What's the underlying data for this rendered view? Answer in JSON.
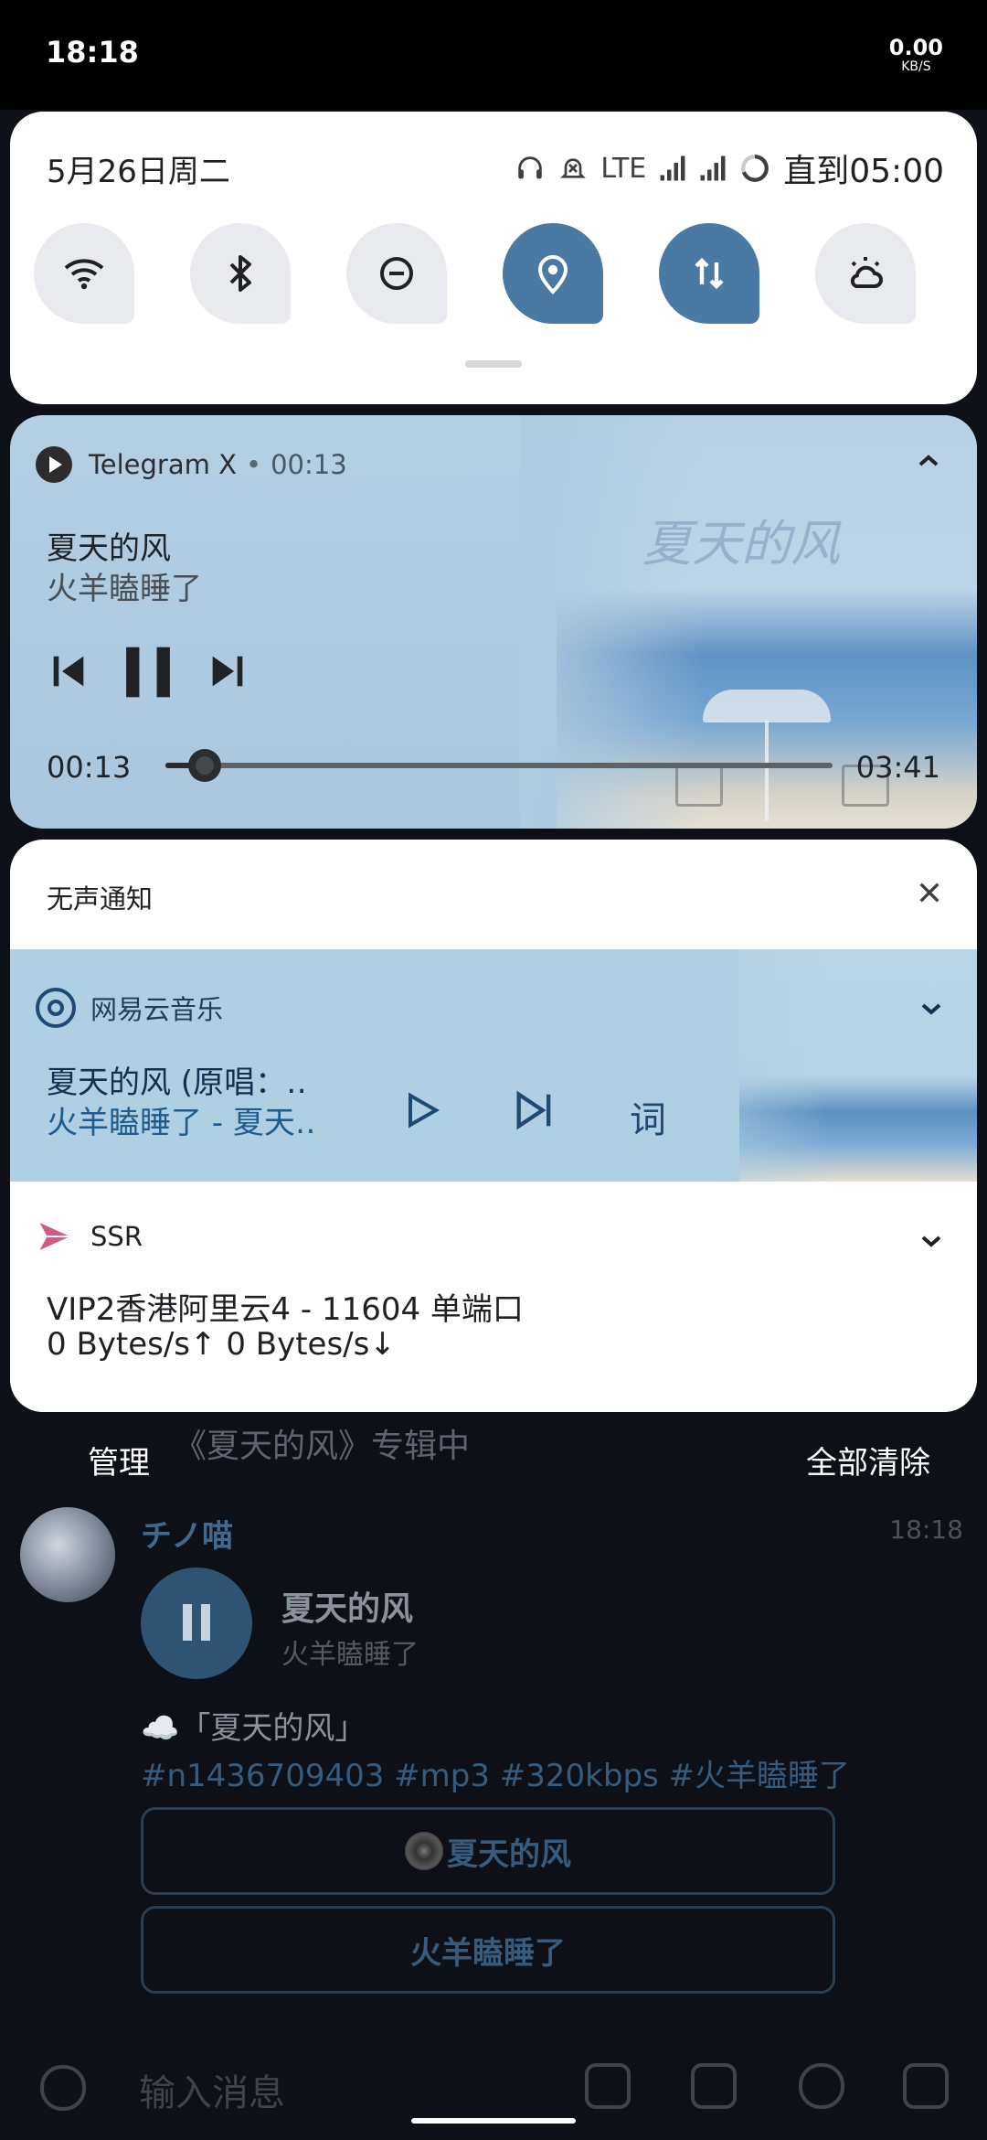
{
  "status_bar": {
    "time": "18:18",
    "speed_value": "0.00",
    "speed_unit": "KB/S"
  },
  "quick_settings": {
    "date": "5月26日周二",
    "network": "LTE",
    "alarm_until": "直到05:00",
    "tiles": [
      {
        "name": "wifi",
        "active": false
      },
      {
        "name": "bluetooth",
        "active": false
      },
      {
        "name": "do-not-disturb",
        "active": false
      },
      {
        "name": "location",
        "active": true
      },
      {
        "name": "mobile-data",
        "active": true
      },
      {
        "name": "weather-night",
        "active": false
      }
    ]
  },
  "media_player": {
    "app": "Telegram X",
    "separator": "•",
    "elapsed_header": "00:13",
    "title": "夏天的风",
    "artist": "火羊瞌睡了",
    "current_time": "00:13",
    "duration": "03:41",
    "progress": 0.059,
    "art_text": "夏天的风"
  },
  "notifications": {
    "section_label": "无声通知",
    "netease": {
      "app": "网易云音乐",
      "title": "夏天的风 (原唱：‥",
      "subtitle": "火羊瞌睡了 - 夏天‥",
      "lyric_button": "词"
    },
    "ssr": {
      "app": "SSR",
      "title": "VIP2香港阿里云4 - 11604 单端口",
      "text": "0 Bytes/s↑ 0 Bytes/s↓"
    },
    "manage_label": "管理",
    "clear_all_label": "全部清除"
  },
  "background_chat": {
    "album_text": "《夏天的风》专辑中",
    "sender": "チノ喵",
    "time": "18:18",
    "song_title": "夏天的风",
    "song_artist": "火羊瞌睡了",
    "caption": "☁️「夏天的风」",
    "tags": "#n1436709403 #mp3 #320kbps #火羊瞌睡了",
    "button1": "夏天的风",
    "button2": "火羊瞌睡了",
    "input_placeholder": "输入消息"
  },
  "colors": {
    "tile_active": "#4a7aa3",
    "tile_inactive": "#e8eaed",
    "media_bg": "#a9c7de",
    "netease_bg": "#aed0e2"
  }
}
